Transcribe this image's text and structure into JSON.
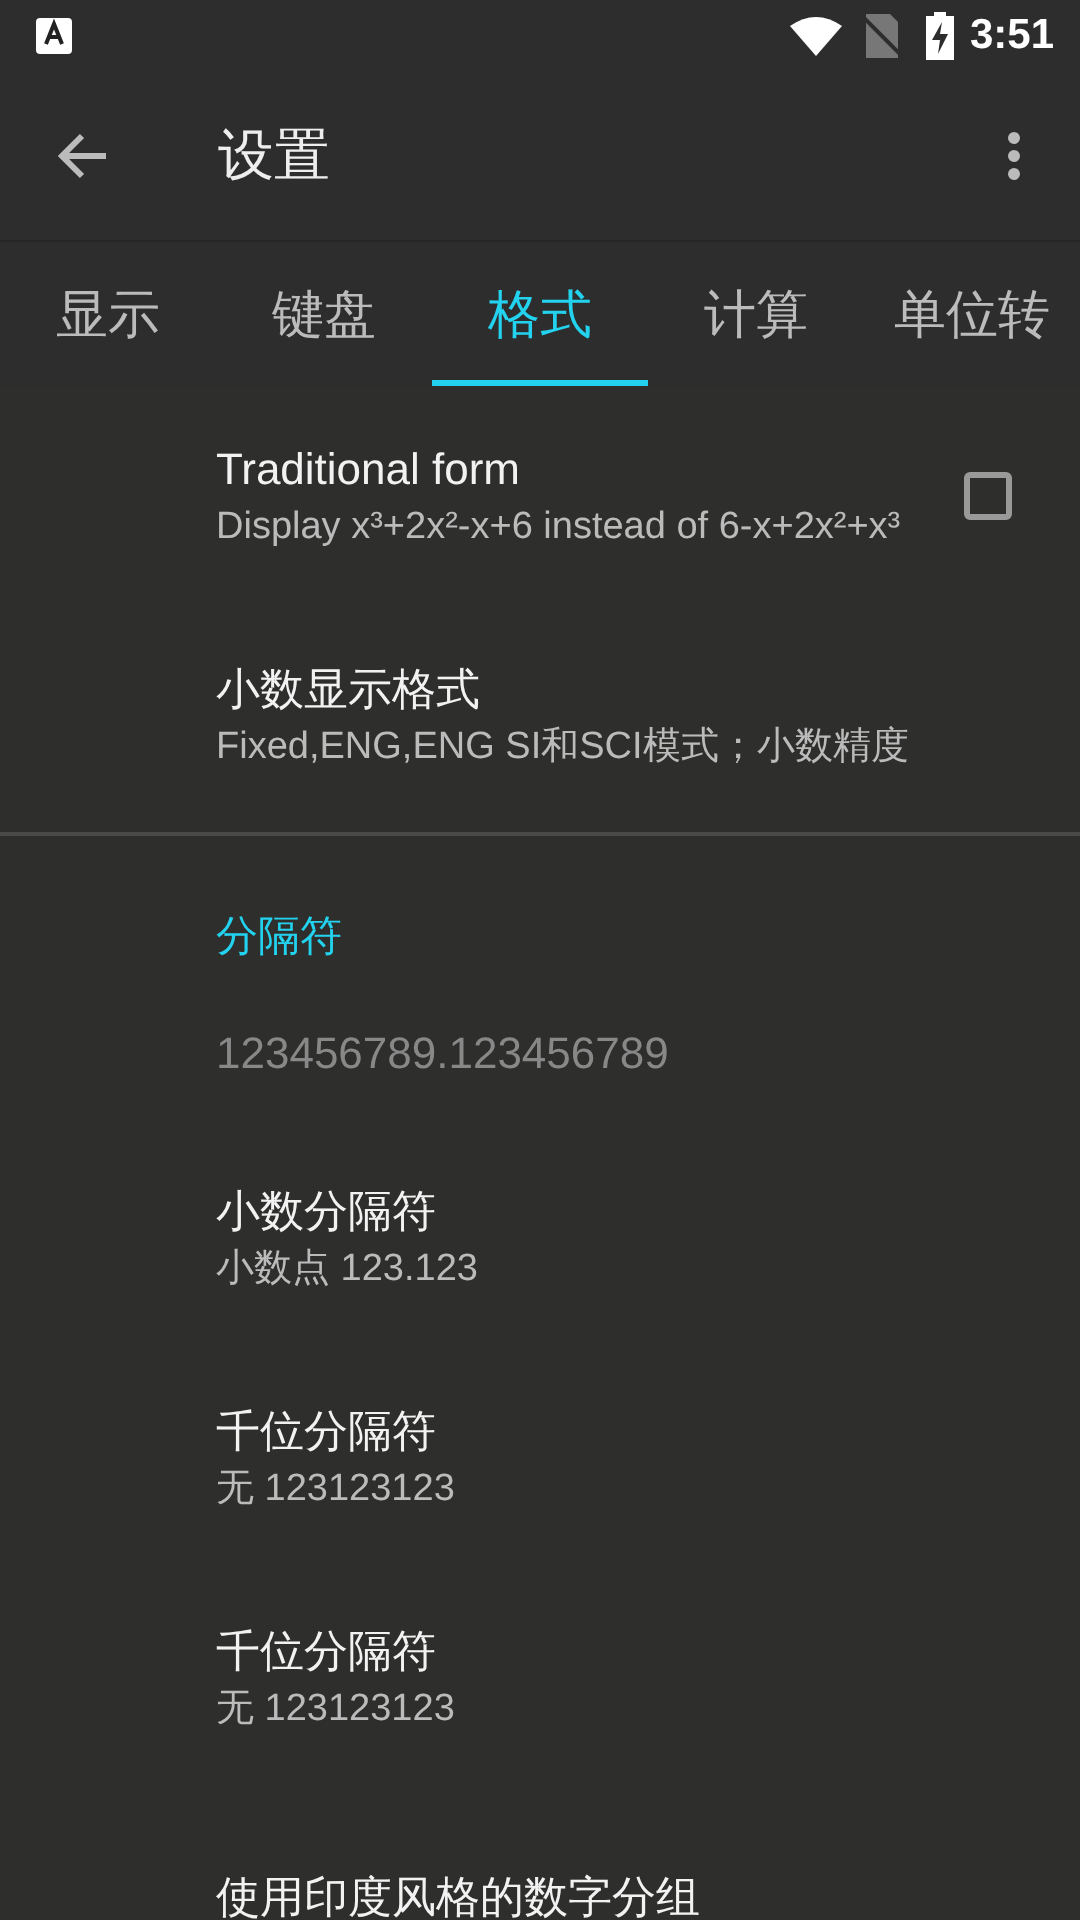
{
  "status_bar": {
    "time": "3:51"
  },
  "toolbar": {
    "title": "设置"
  },
  "tabs": [
    {
      "label": "显示",
      "selected": false
    },
    {
      "label": "键盘",
      "selected": false
    },
    {
      "label": "格式",
      "selected": true
    },
    {
      "label": "计算",
      "selected": false
    },
    {
      "label": "单位转",
      "selected": false
    }
  ],
  "settings": [
    {
      "kind": "checkbox",
      "title": "Traditional form",
      "summary": "Display x³+2x²-x+6 instead of 6-x+2x²+x³",
      "checked": false
    },
    {
      "kind": "text",
      "title": "小数显示格式",
      "summary": "Fixed,ENG,ENG SI和SCI模式；小数精度"
    },
    {
      "kind": "divider"
    },
    {
      "kind": "category",
      "title": "分隔符"
    },
    {
      "kind": "preview",
      "text": "123456789.123456789"
    },
    {
      "kind": "text",
      "title": "小数分隔符",
      "summary": "小数点 123.123"
    },
    {
      "kind": "text",
      "title": "千位分隔符",
      "summary": "无 123123123"
    },
    {
      "kind": "text",
      "title": "千位分隔符",
      "summary": "无 123123123"
    },
    {
      "kind": "text",
      "title": "使用印度风格的数字分组"
    }
  ]
}
